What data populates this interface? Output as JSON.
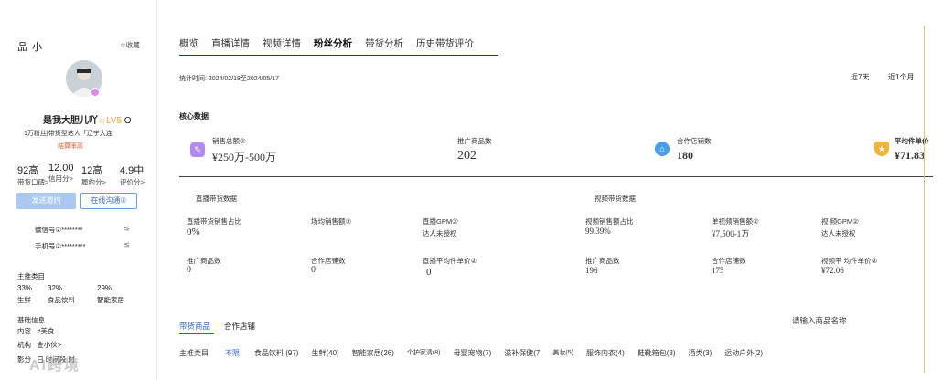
{
  "sidebar": {
    "brand": "品 小",
    "favorite": "☆收藏",
    "name": "是我大胆儿吖",
    "level": "☆LV5",
    "level_suffix": "O",
    "desc": "1万粉丝|带货型达人「辽宁大连",
    "settle": "结算率高",
    "stats": [
      {
        "value": "92高",
        "label": "带货口碑>"
      },
      {
        "value": "12.00",
        "label": "信用分>"
      },
      {
        "value": "12高",
        "label": "履约分>"
      },
      {
        "value": "4.9中",
        "label": "评价分>"
      }
    ],
    "btn_invite": "发送邀约",
    "btn_chat": "在线沟通②",
    "wechat_label": "微信号②********",
    "phone_label": "手机号②*********",
    "main_category_title": "主推类目",
    "main_categories": [
      {
        "pct": "33%",
        "name": "生鲜"
      },
      {
        "pct": "32%",
        "name": "食品饮料"
      },
      {
        "pct": "29%",
        "name": "智能家居"
      }
    ],
    "basic_info_title": "基础信息",
    "basic_rows": [
      {
        "label": "内容",
        "value": "#美食"
      },
      {
        "label": "机构",
        "value": "金小伙>"
      },
      {
        "label": "影分",
        "value": "日 时间段 时"
      }
    ],
    "watermark": "AI跨境"
  },
  "tabs": [
    "概览",
    "直播详情",
    "视频详情",
    "粉丝分析",
    "带货分析",
    "历史带货评价"
  ],
  "active_tab": 3,
  "stats_period": "统计时间: 2024/02/18至2024/05/17",
  "range_7": "近7天",
  "range_30": "近1个月",
  "core": {
    "title": "核心数据",
    "items": [
      {
        "label": "销售总额②",
        "value": "¥250万-500万",
        "icon": "edit-icon",
        "color": "#b48af0"
      },
      {
        "label": "推广商品数",
        "value": "202",
        "icon": "",
        "color": ""
      },
      {
        "label": "合作店铺数",
        "value": "180",
        "icon": "shop-icon",
        "color": "#4a9ee8"
      },
      {
        "label": "平均件单价",
        "value": "¥71.83",
        "icon": "medal-icon",
        "color": "#f0b43c"
      }
    ]
  },
  "live": {
    "title": "直播带货数据",
    "row1": [
      {
        "label": "直播带货销售占比",
        "value": "0%"
      },
      {
        "label": "场均销售额②",
        "value": ""
      },
      {
        "label": "直播GPM②",
        "value": "达人未授权"
      }
    ],
    "row2": [
      {
        "label": "推广商品数",
        "value": "0"
      },
      {
        "label": "合作店铺数",
        "value": "0"
      },
      {
        "label": "直播平均件单价②",
        "value": "0"
      }
    ]
  },
  "video": {
    "title": "视频带货数据",
    "row1": [
      {
        "label": "视频销售额占比",
        "value": "99.39%"
      },
      {
        "label": "单视频销售额②",
        "value": "¥7,500-1万"
      },
      {
        "label": "视 频GPM②",
        "value": "达人未授权"
      }
    ],
    "row2": [
      {
        "label": "推广商品数",
        "value": "196"
      },
      {
        "label": "合作店铺数",
        "value": "175"
      },
      {
        "label": "视频平 均件单价②",
        "value": "¥72.06"
      }
    ]
  },
  "bottom": {
    "tab1": "带货商品",
    "tab2": "合作店铺",
    "search_placeholder": "请输入商品名称",
    "category_label": "主推类目",
    "categories": [
      "不限",
      "食品饮料 (97)",
      "生鲜(40)",
      "智能家居(26)",
      "个护家清(8)",
      "母婴宠物(7)",
      "滋补保健(7",
      "美妆(5)",
      "服饰内衣(4)",
      "鞋靴箱包(3)",
      "酒类(3)",
      "运动户外(2)"
    ]
  }
}
